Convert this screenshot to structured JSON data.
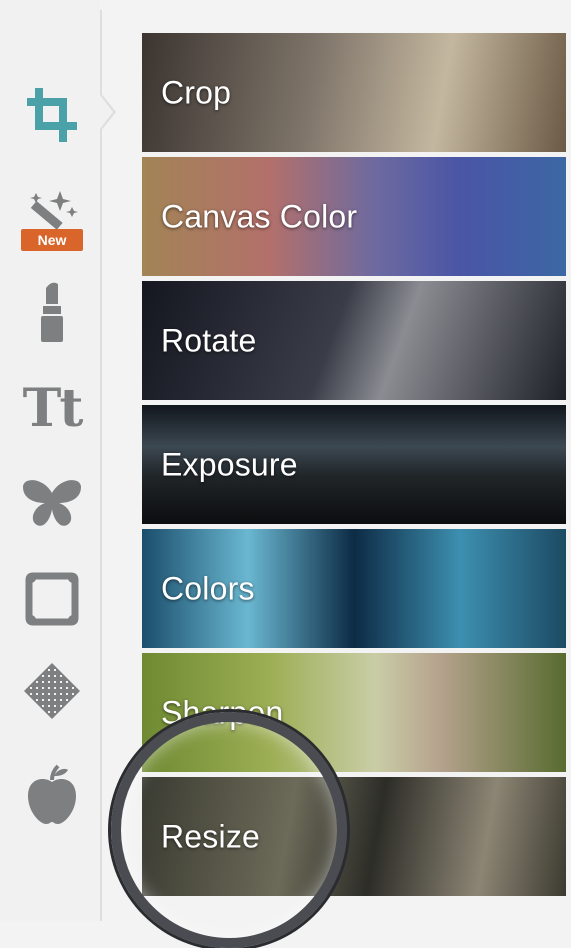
{
  "sidebar": {
    "active_color": "#4aa2a8",
    "icon_color": "#7d7f80",
    "tools": [
      {
        "name": "crop",
        "icon": "crop-icon",
        "active": true
      },
      {
        "name": "magic-wand",
        "icon": "magic-wand-icon",
        "badge": "New"
      },
      {
        "name": "lipstick",
        "icon": "lipstick-icon"
      },
      {
        "name": "text",
        "icon": "text-icon",
        "glyph": "Tt"
      },
      {
        "name": "butterfly",
        "icon": "butterfly-icon"
      },
      {
        "name": "frame",
        "icon": "frame-icon"
      },
      {
        "name": "texture",
        "icon": "texture-icon"
      },
      {
        "name": "apple",
        "icon": "apple-icon"
      }
    ],
    "badge_color": "#d9652b"
  },
  "panel": {
    "items": [
      {
        "label": "Crop"
      },
      {
        "label": "Canvas Color"
      },
      {
        "label": "Rotate"
      },
      {
        "label": "Exposure"
      },
      {
        "label": "Colors"
      },
      {
        "label": "Sharpen"
      },
      {
        "label": "Resize"
      }
    ]
  }
}
